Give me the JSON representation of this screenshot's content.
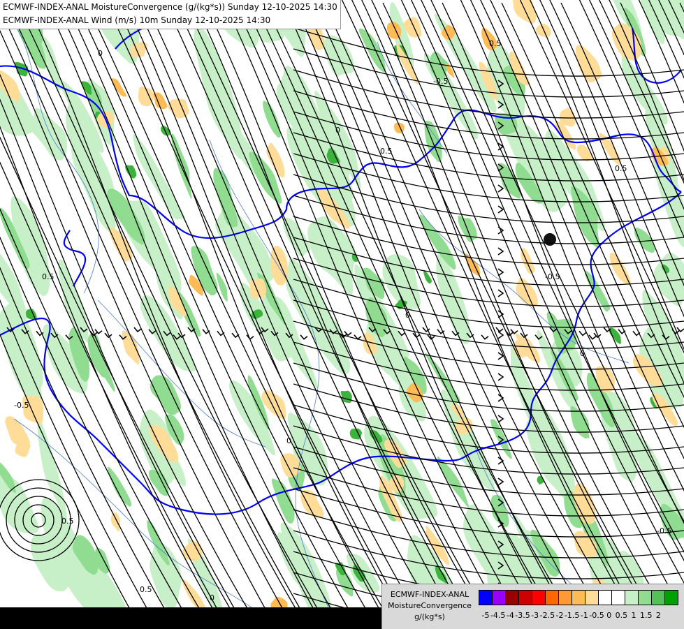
{
  "title": {
    "line1": "ECMWF-INDEX-ANAL MoistureConvergence (g/(kg*s)) Sunday 12-10-2025 14:30",
    "line2": "ECMWF-INDEX-ANAL Wind (m/s) 10m Sunday 12-10-2025 14:30"
  },
  "legend": {
    "model": "ECMWF-INDEX-ANAL",
    "parameter": "MoistureConvergence",
    "unit": "g/(kg*s)",
    "ticks": [
      "-5",
      "-4.5",
      "-4",
      "-3.5",
      "-3",
      "-2.5",
      "-2",
      "-1.5",
      "-1",
      "-0.5",
      "0",
      "0.5",
      "1",
      "1.5",
      "2"
    ],
    "colors": [
      "#0000ff",
      "#9900ff",
      "#990000",
      "#cc0000",
      "#ff0000",
      "#ff6600",
      "#ff9933",
      "#ffbb55",
      "#ffdd99",
      "#ffffff",
      "#ffffff",
      "#c8f0c8",
      "#90dc90",
      "#55c055",
      "#00a000"
    ]
  },
  "map": {
    "contour_labels": [
      "0",
      "0.5",
      "-0.5",
      "0.5",
      "0",
      "0.5",
      "-0.5",
      "0",
      "0.5",
      "-0.5",
      "0",
      "0.5",
      "0",
      "-0.5",
      "0.5",
      "0"
    ],
    "colors": {
      "background": "#ffffff",
      "convergence_light": "#c8f0c8",
      "convergence_mid": "#90dc90",
      "convergence_strong": "#3cb43c",
      "divergence_light": "#ffdd99",
      "divergence_mid": "#ffbb55",
      "border": "#0000ff",
      "river": "#4a7ccf",
      "streamline": "#000000"
    }
  }
}
